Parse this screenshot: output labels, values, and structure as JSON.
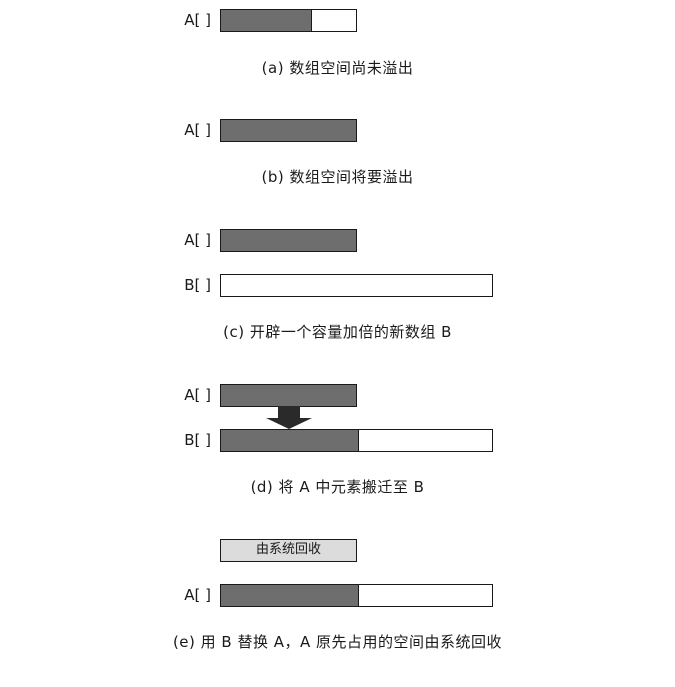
{
  "colors": {
    "filled": "#6e6e6e",
    "empty": "#ffffff",
    "freed": "#dcdcdc",
    "stroke": "#1a1a1a"
  },
  "labels": {
    "array_a": "A[ ]",
    "array_b": "B[ ]"
  },
  "panels": [
    {
      "caption": "(a)  数组空间尚未溢出",
      "arrays": [
        {
          "label": "A[ ]",
          "capacity": 1,
          "fill_fraction": 0.67
        }
      ]
    },
    {
      "caption": "(b)  数组空间将要溢出",
      "arrays": [
        {
          "label": "A[ ]",
          "capacity": 1,
          "fill_fraction": 1.0
        }
      ]
    },
    {
      "caption": "(c)  开辟一个容量加倍的新数组 B",
      "arrays": [
        {
          "label": "A[ ]",
          "capacity": 1,
          "fill_fraction": 1.0
        },
        {
          "label": "B[ ]",
          "capacity": 2,
          "fill_fraction": 0.0
        }
      ]
    },
    {
      "caption": "(d)  将 A 中元素搬迁至 B",
      "arrays": [
        {
          "label": "A[ ]",
          "capacity": 1,
          "fill_fraction": 1.0
        },
        {
          "label": "B[ ]",
          "capacity": 2,
          "fill_fraction": 0.5
        }
      ],
      "arrow": "down-arrow-icon"
    },
    {
      "caption": "(e)  用 B 替换 A，A 原先占用的空间由系统回收",
      "freed_label": "由系统回收",
      "arrays": [
        {
          "label": "A[ ]",
          "capacity": 2,
          "fill_fraction": 0.5
        }
      ]
    }
  ]
}
